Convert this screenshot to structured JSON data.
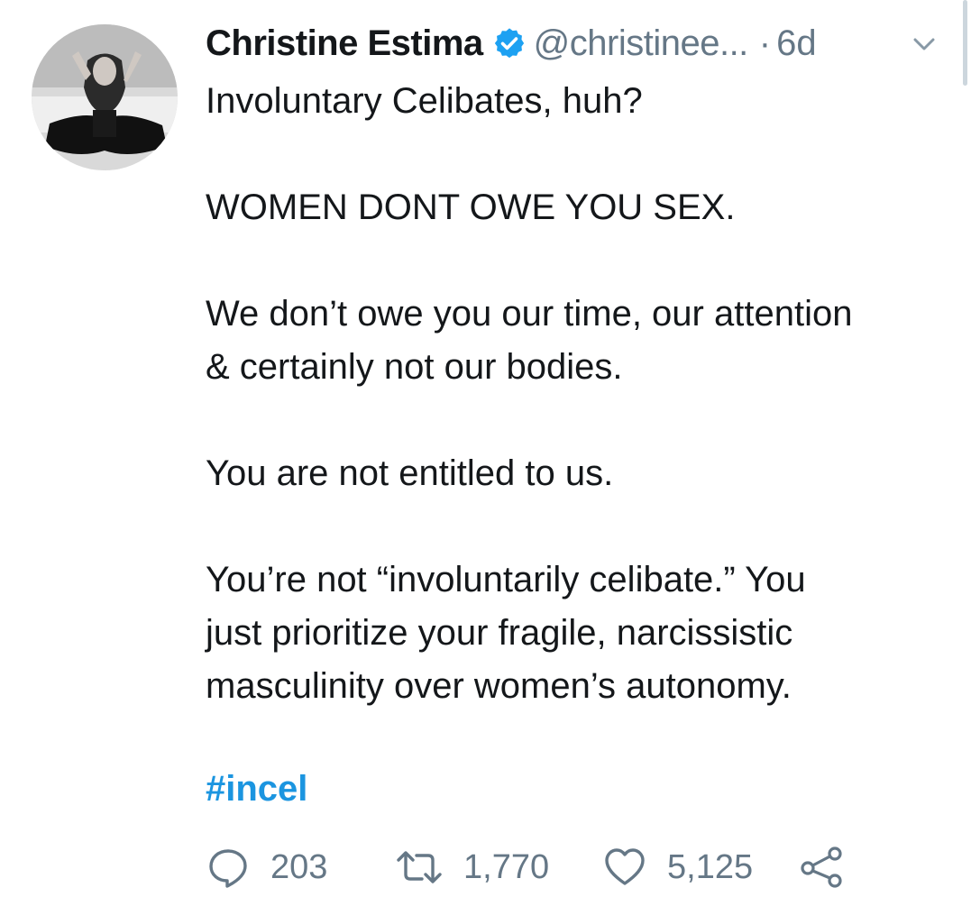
{
  "tweet": {
    "author_name": "Christine Estima",
    "handle": "@christinee...",
    "separator": "·",
    "time": "6d",
    "paragraphs": [
      [
        "Involuntary Celibates, huh?"
      ],
      [
        "WOMEN DONT OWE YOU SEX."
      ],
      [
        "We don’t owe you our time, our attention",
        "& certainly not our bodies."
      ],
      [
        "You are not entitled to us."
      ],
      [
        "You’re not “involuntarily celibate.” You",
        "just prioritize your fragile, narcissistic",
        "masculinity over women’s autonomy."
      ]
    ],
    "hashtag": "#incel",
    "replies": "203",
    "retweets": "1,770",
    "likes": "5,125"
  },
  "colors": {
    "verified": "#1da1f2",
    "hashtag": "#1b95e0",
    "secondary_text": "#657786",
    "primary_text": "#14171a"
  },
  "icons": {
    "verified": "verified-badge-icon",
    "menu": "chevron-down-icon",
    "reply": "reply-icon",
    "retweet": "retweet-icon",
    "like": "heart-icon",
    "share": "share-icon"
  }
}
